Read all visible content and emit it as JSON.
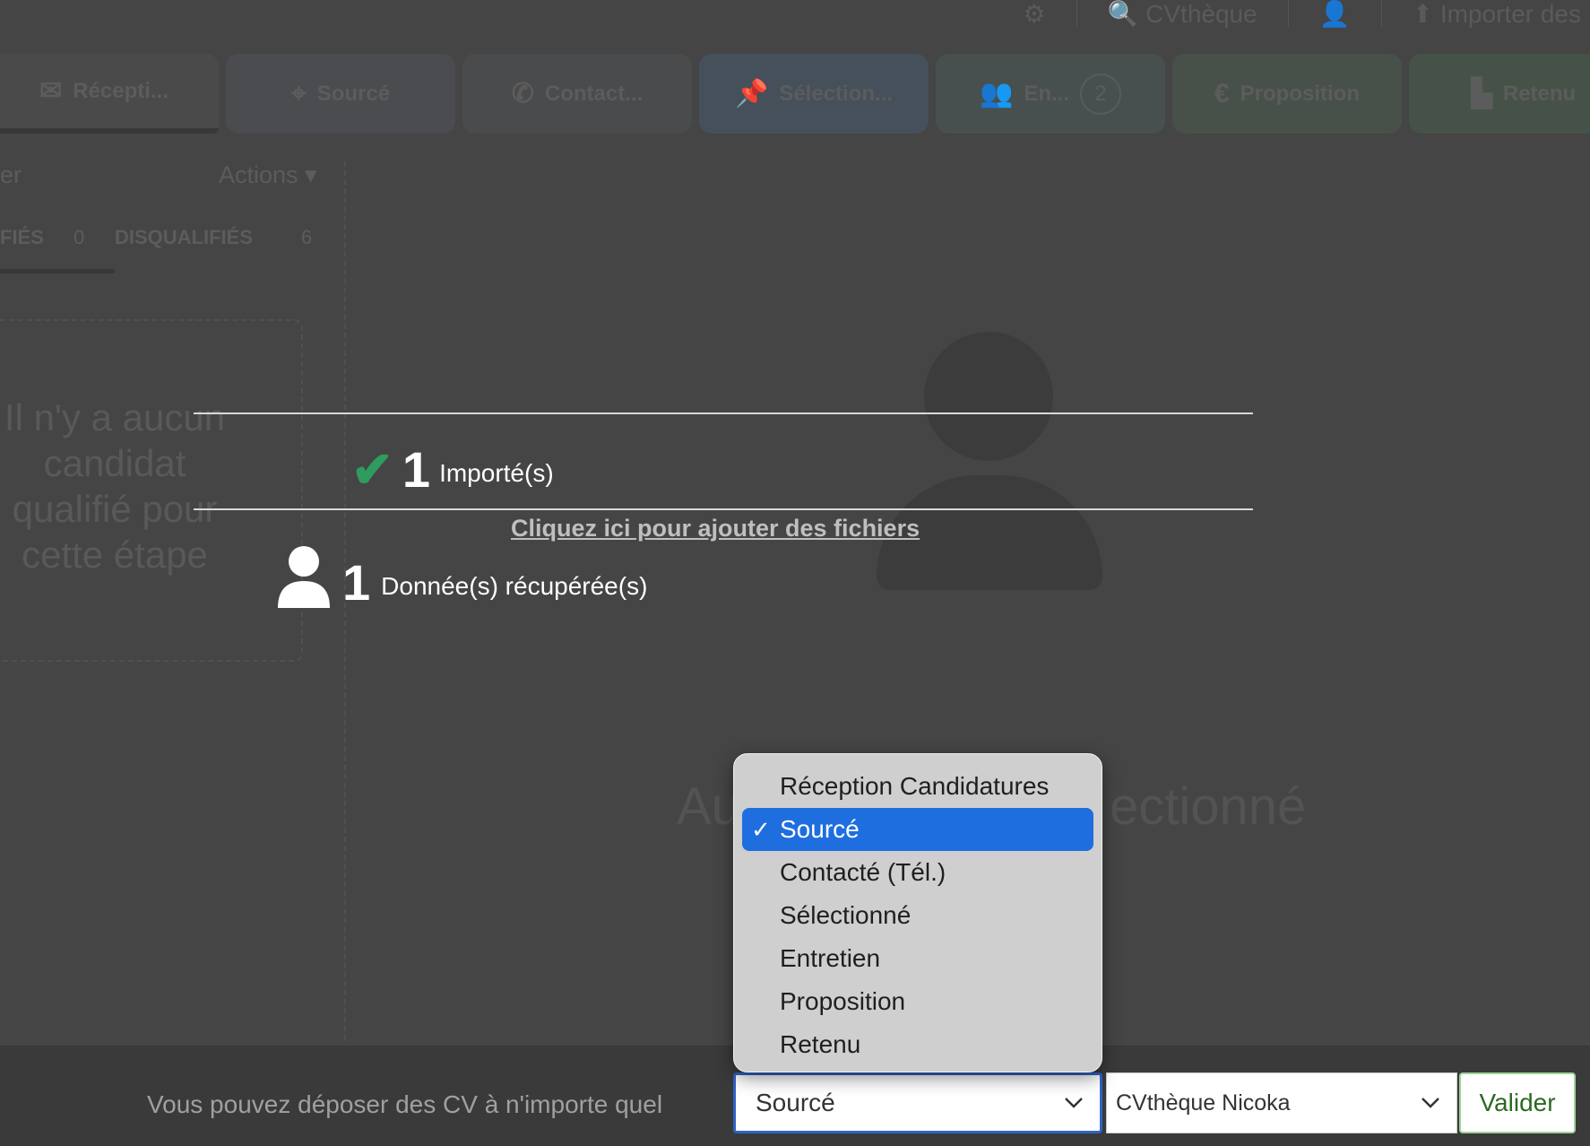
{
  "topbar": {
    "cvtheque": "CVthèque",
    "import": "Importer des"
  },
  "stages": [
    {
      "icon": "✉",
      "label": "Récepti...",
      "badge": ""
    },
    {
      "icon": "⌖",
      "label": "Sourcé",
      "badge": ""
    },
    {
      "icon": "✆",
      "label": "Contact...",
      "badge": ""
    },
    {
      "icon": "📌",
      "label": "Sélection...",
      "badge": ""
    },
    {
      "icon": "👥",
      "label": "En...",
      "badge": "2"
    },
    {
      "icon": "€",
      "label": "Proposition",
      "badge": ""
    },
    {
      "icon": "▙",
      "label": "Retenu",
      "badge": ""
    }
  ],
  "left": {
    "header_partial": "er",
    "actions": "Actions ▾",
    "tab_qualified_partial": "FIÉS",
    "tab_qualified_count": "0",
    "tab_disqualified": "DISQUALIFIÉS",
    "tab_disqualified_count": "6",
    "empty_message": "Il n'y a aucun candidat qualifié pour cette étape"
  },
  "main": {
    "none_selected_partial_left": "Au",
    "none_selected_partial_right": "ectionné"
  },
  "upload": {
    "imported_count": "1",
    "imported_label": "Importé(s)",
    "add_files": "Cliquez ici pour ajouter des fichiers",
    "recovered_count": "1",
    "recovered_label": "Donnée(s) récupérée(s)"
  },
  "bottom": {
    "message": "Vous pouvez déposer des CV à n'importe quel",
    "stage_select_value": "Sourcé",
    "cv_select_value": "CVthèque Nicoka",
    "valider": "Valider"
  },
  "dropdown": {
    "options": [
      "Réception Candidatures",
      "Sourcé",
      "Contacté (Tél.)",
      "Sélectionné",
      "Entretien",
      "Proposition",
      "Retenu"
    ],
    "selected_index": 1,
    "check_glyph": "✓"
  },
  "colors": {
    "overlay": "#454545",
    "check_green": "#2e9b5f",
    "selected_blue": "#1e6ee0",
    "valider_text": "#2b6a21"
  }
}
